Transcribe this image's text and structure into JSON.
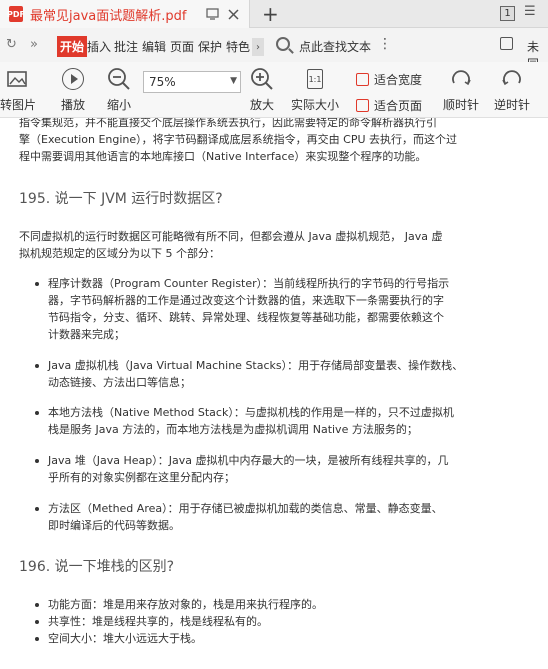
{
  "tabbar": {
    "title": "最常见java面试题解析.pdf",
    "page_count": "1",
    "icons": {
      "file": "PDF",
      "screen": "screen-icon",
      "close": "close-icon",
      "new_tab": "plus-icon",
      "menu": "hamburger-icon"
    }
  },
  "menu": {
    "items": [
      "开始",
      "插入",
      "批注",
      "编辑",
      "页面",
      "保护",
      "特色"
    ],
    "active": "开始",
    "search_label": "点此查找文本",
    "cut_label": "未同"
  },
  "toolbar": {
    "rotate_label": "转图片",
    "play_label": "播放",
    "zoom_out_label": "缩小",
    "zoom_value": "75%",
    "zoom_in_label": "放大",
    "actual_size_label": "实际大小",
    "actual_size_icon_text": "1:1",
    "fit_width_label": "适合宽度",
    "fit_page_label": "适合页面",
    "cw_label": "顺时针",
    "ccw_label": "逆时针"
  },
  "doc": {
    "intro_lines": [
      "指令集规范，并不能直接交个底层操作系统去执行，因此需要特定的命令解析器执行引",
      "擎（Execution Engine），将字节码翻译成底层系统指令，再交由 CPU 去执行，而这个过",
      "程中需要调用其他语言的本地库接口（Native Interface）来实现整个程序的功能。"
    ],
    "h195": "195. 说一下 JVM 运行时数据区?",
    "p195_lines": [
      "不同虚拟机的运行时数据区可能略微有所不同，但都会遵从 Java 虚拟机规范， Java 虚",
      "拟机规范规定的区域分为以下 5 个部分："
    ],
    "list195": [
      [
        "程序计数器（Program Counter Register）：当前线程所执行的字节码的行号指示",
        "器，字节码解析器的工作是通过改变这个计数器的值，来选取下一条需要执行的字",
        "节码指令，分支、循环、跳转、异常处理、线程恢复等基础功能，都需要依赖这个",
        "计数器来完成；"
      ],
      [
        "Java 虚拟机栈（Java Virtual Machine Stacks）：用于存储局部变量表、操作数栈、",
        "动态链接、方法出口等信息；"
      ],
      [
        "本地方法栈（Native Method Stack）：与虚拟机栈的作用是一样的，只不过虚拟机",
        "栈是服务 Java 方法的，而本地方法栈是为虚拟机调用 Native 方法服务的；"
      ],
      [
        "Java 堆（Java Heap）：Java 虚拟机中内存最大的一块，是被所有线程共享的，几",
        "乎所有的对象实例都在这里分配内存；"
      ],
      [
        "方法区（Methed Area）：用于存储已被虚拟机加载的类信息、常量、静态变量、",
        "即时编译后的代码等数据。"
      ]
    ],
    "h196": "196. 说一下堆栈的区别?",
    "list196": [
      "功能方面：堆是用来存放对象的，栈是用来执行程序的。",
      "共享性：堆是线程共享的，栈是线程私有的。",
      "空间大小：堆大小远远大于栈。"
    ]
  }
}
